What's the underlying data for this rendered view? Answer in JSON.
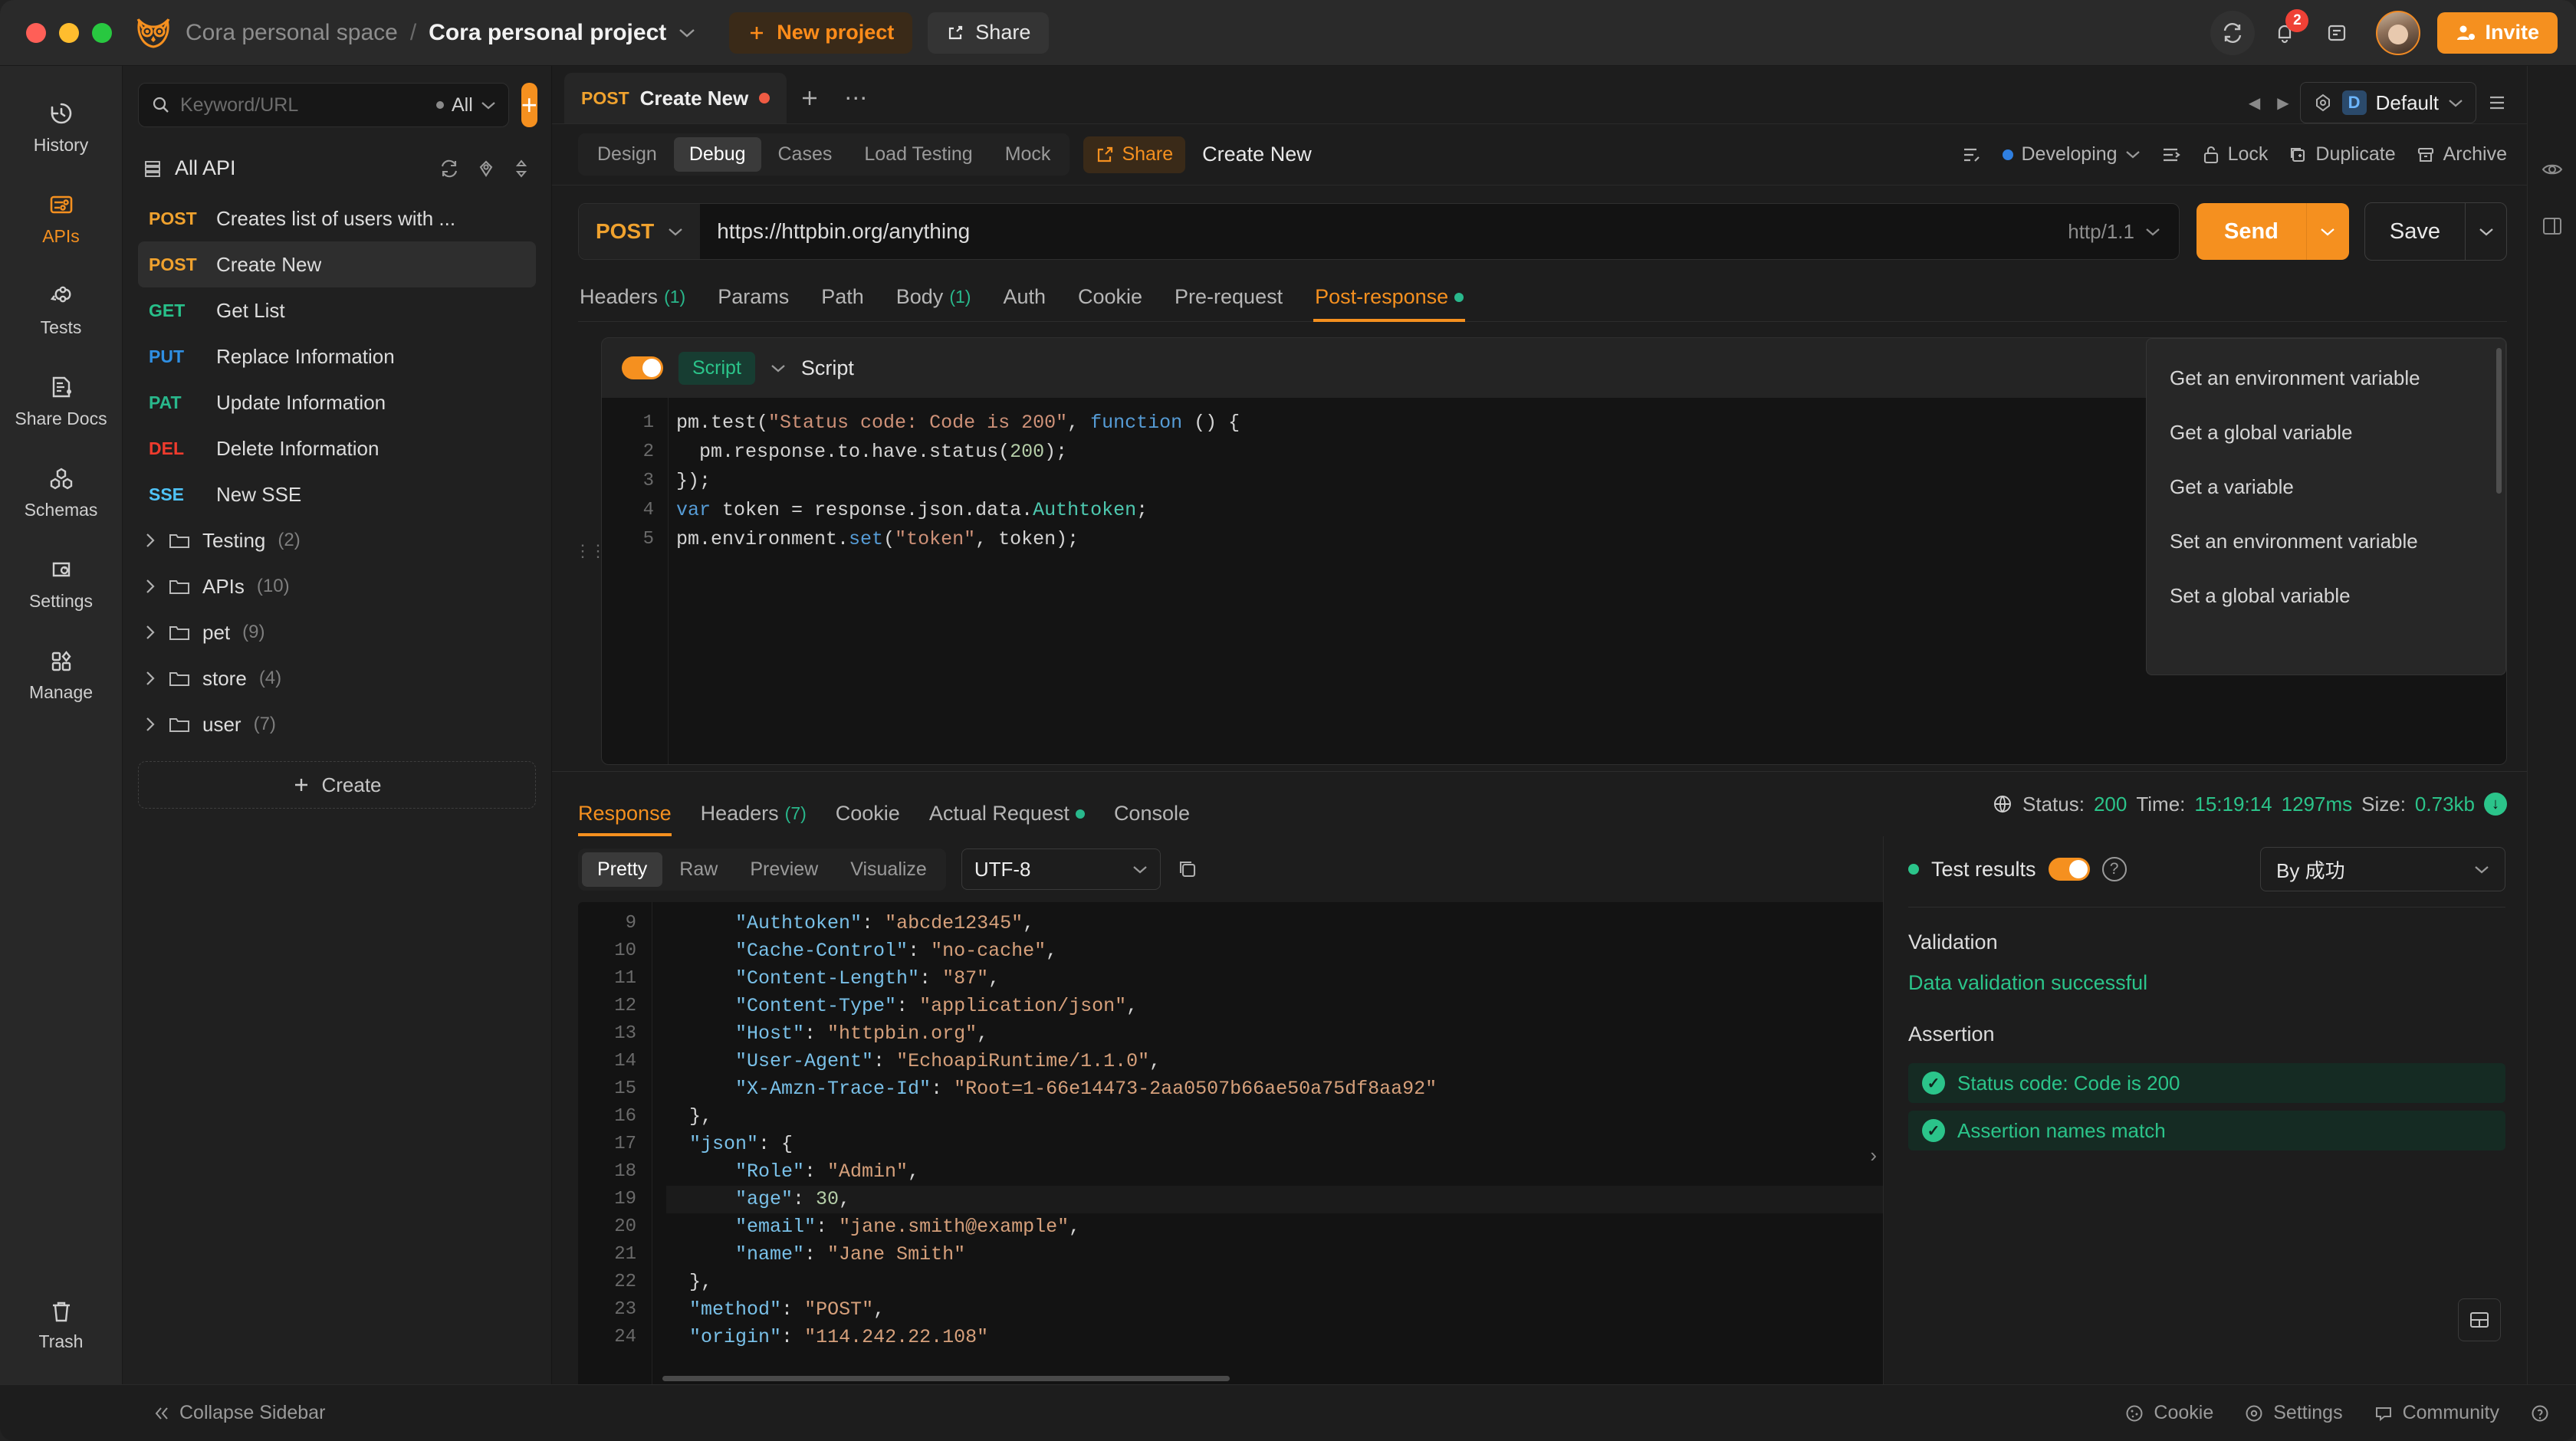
{
  "titlebar": {
    "space": "Cora personal space",
    "separator": "/",
    "project": "Cora personal project",
    "new_project": "New project",
    "share": "Share",
    "notification_count": "2",
    "invite": "Invite"
  },
  "rail": {
    "items": [
      {
        "label": "History",
        "icon": "history-icon",
        "active": false
      },
      {
        "label": "APIs",
        "icon": "apis-icon",
        "active": true
      },
      {
        "label": "Tests",
        "icon": "tests-icon",
        "active": false
      },
      {
        "label": "Share Docs",
        "icon": "share-docs-icon",
        "active": false
      },
      {
        "label": "Schemas",
        "icon": "schemas-icon",
        "active": false
      },
      {
        "label": "Settings",
        "icon": "settings-icon",
        "active": false
      },
      {
        "label": "Manage",
        "icon": "manage-icon",
        "active": false
      }
    ],
    "trash": "Trash"
  },
  "listpanel": {
    "search_placeholder": "Keyword/URL",
    "search_value": "",
    "scope": "All",
    "add_label": "+",
    "all_api": "All API",
    "apis": [
      {
        "method": "POST",
        "cls": "post",
        "name": "Creates list of users with ...",
        "selected": false
      },
      {
        "method": "POST",
        "cls": "post",
        "name": "Create New",
        "selected": true
      },
      {
        "method": "GET",
        "cls": "get",
        "name": "Get List",
        "selected": false
      },
      {
        "method": "PUT",
        "cls": "put",
        "name": "Replace Information",
        "selected": false
      },
      {
        "method": "PAT",
        "cls": "pat",
        "name": "Update Information",
        "selected": false
      },
      {
        "method": "DEL",
        "cls": "del",
        "name": "Delete Information",
        "selected": false
      },
      {
        "method": "SSE",
        "cls": "sse",
        "name": "New SSE",
        "selected": false
      }
    ],
    "folders": [
      {
        "name": "Testing",
        "count": "(2)"
      },
      {
        "name": "APIs",
        "count": "(10)"
      },
      {
        "name": "pet",
        "count": "(9)"
      },
      {
        "name": "store",
        "count": "(4)"
      },
      {
        "name": "user",
        "count": "(7)"
      }
    ],
    "create": "Create"
  },
  "tabbar": {
    "tab_method": "POST",
    "tab_name": "Create New",
    "env_badge": "D",
    "env_name": "Default"
  },
  "toolbar": {
    "segments": [
      "Design",
      "Debug",
      "Cases",
      "Load Testing",
      "Mock"
    ],
    "active_segment": "Debug",
    "share": "Share",
    "doc_name": "Create New",
    "status": "Developing",
    "lock": "Lock",
    "duplicate": "Duplicate",
    "archive": "Archive"
  },
  "request": {
    "method": "POST",
    "url": "https://httpbin.org/anything",
    "http_version": "http/1.1",
    "send": "Send",
    "save": "Save",
    "tabs": [
      {
        "label": "Headers",
        "count": "(1)",
        "active": false,
        "dot": false
      },
      {
        "label": "Params",
        "count": "",
        "active": false,
        "dot": false
      },
      {
        "label": "Path",
        "count": "",
        "active": false,
        "dot": false
      },
      {
        "label": "Body",
        "count": "(1)",
        "active": false,
        "dot": false
      },
      {
        "label": "Auth",
        "count": "",
        "active": false,
        "dot": false
      },
      {
        "label": "Cookie",
        "count": "",
        "active": false,
        "dot": false
      },
      {
        "label": "Pre-request",
        "count": "",
        "active": false,
        "dot": false
      },
      {
        "label": "Post-response",
        "count": "",
        "active": true,
        "dot": true
      }
    ]
  },
  "script": {
    "chip": "Script",
    "title": "Script",
    "toggle_on": true,
    "line_numbers": [
      "1",
      "2",
      "3",
      "4",
      "5"
    ],
    "lines": [
      "pm.test(\"Status code: Code is 200\", function () {",
      "  pm.response.to.have.status(200);",
      "});",
      "var token = response.json.data.Authtoken;",
      "pm.environment.set(\"token\", token);"
    ]
  },
  "popup_menu": {
    "items": [
      "Get an environment variable",
      "Get a global variable",
      "Get a variable",
      "Set an environment variable",
      "Set a global variable"
    ]
  },
  "response": {
    "tabs": [
      {
        "label": "Response",
        "count": "",
        "active": true,
        "dot": false
      },
      {
        "label": "Headers",
        "count": "(7)",
        "active": false,
        "dot": false
      },
      {
        "label": "Cookie",
        "count": "",
        "active": false,
        "dot": false
      },
      {
        "label": "Actual Request",
        "count": "",
        "active": false,
        "dot": true
      },
      {
        "label": "Console",
        "count": "",
        "active": false,
        "dot": false
      }
    ],
    "status_label": "Status:",
    "status_value": "200",
    "time_label": "Time:",
    "time_value": "15:19:14",
    "duration": "1297ms",
    "size_label": "Size:",
    "size_value": "0.73kb",
    "view_modes": [
      "Pretty",
      "Raw",
      "Preview",
      "Visualize"
    ],
    "active_view": "Pretty",
    "encoding": "UTF-8",
    "body_line_numbers": [
      "9",
      "10",
      "11",
      "12",
      "13",
      "14",
      "15",
      "16",
      "17",
      "18",
      "19",
      "20",
      "21",
      "22",
      "23",
      "24"
    ],
    "body_lines": [
      "      \"Authtoken\": \"abcde12345\",",
      "      \"Cache-Control\": \"no-cache\",",
      "      \"Content-Length\": \"87\",",
      "      \"Content-Type\": \"application/json\",",
      "      \"Host\": \"httpbin.org\",",
      "      \"User-Agent\": \"EchoapiRuntime/1.1.0\",",
      "      \"X-Amzn-Trace-Id\": \"Root=1-66e14473-2aa0507b66ae50a75df8aa92\"",
      "  },",
      "  \"json\": {",
      "      \"Role\": \"Admin\",",
      "      \"age\": 30,",
      "      \"email\": \"jane.smith@example\",",
      "      \"name\": \"Jane Smith\"",
      "  },",
      "  \"method\": \"POST\",",
      "  \"origin\": \"114.242.22.108\""
    ]
  },
  "test_results": {
    "title": "Test results",
    "toggle_on": true,
    "sort_by": "By 成功",
    "validation_title": "Validation",
    "validation_message": "Data validation successful",
    "assertion_title": "Assertion",
    "assertions": [
      "Status code: Code is 200",
      "Assertion names match"
    ]
  },
  "footer": {
    "collapse": "Collapse Sidebar",
    "cookie": "Cookie",
    "settings": "Settings",
    "community": "Community"
  },
  "colors": {
    "accent": "#f5901f",
    "success": "#2bc48a",
    "danger": "#ef3b2d",
    "info": "#2f7fe0"
  }
}
